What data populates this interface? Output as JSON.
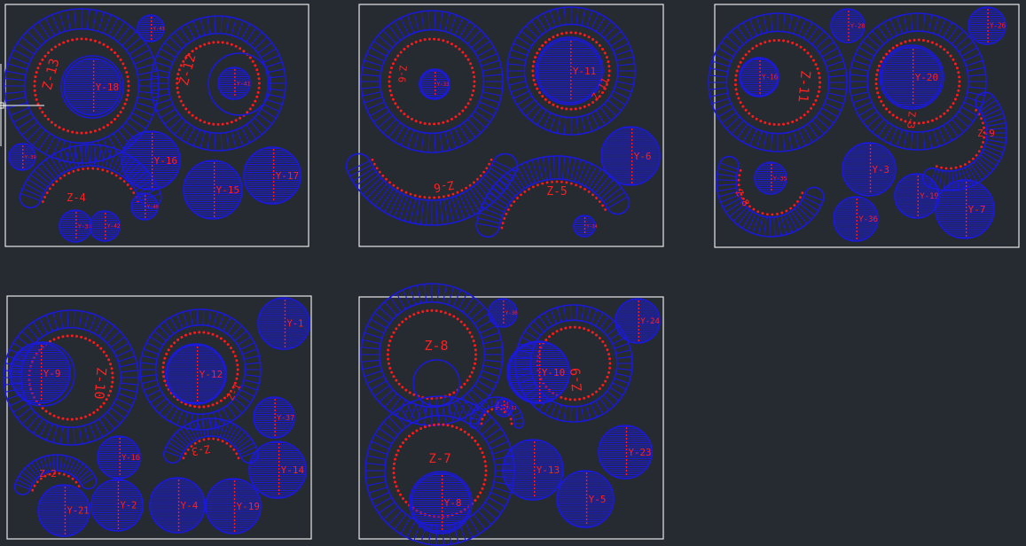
{
  "colors": {
    "background": "#262a31",
    "frame": "#e8e8e8",
    "part": "#1a1ad8",
    "mark": "#ff1a1a"
  },
  "sheets": [
    {
      "rings": [
        {
          "label": "Z-13",
          "lrot": -75,
          "lsize": 15
        },
        {
          "label": "Z-12",
          "lrot": -75,
          "lsize": 15
        }
      ],
      "arcs": [
        {
          "label": "Z-4",
          "lrot": 0,
          "lsize": 12
        }
      ],
      "discs": [
        {
          "label": "Y-18"
        },
        {
          "label": "Y-16"
        },
        {
          "label": "Y-15"
        },
        {
          "label": "Y-17"
        },
        {
          "label": "Y-41"
        },
        {
          "label": "Y-43"
        },
        {
          "label": "Y-39"
        },
        {
          "label": "Y-40"
        },
        {
          "label": "Y-38"
        },
        {
          "label": "Y-42"
        }
      ]
    },
    {
      "rings": [
        {
          "label": "Z-6",
          "lrot": 95,
          "lsize": 11
        },
        {
          "label": "Z-11",
          "lrot": -60,
          "lsize": 11
        }
      ],
      "arcs": [
        {
          "label": "Z-6",
          "lrot": 170,
          "lsize": 13
        },
        {
          "label": "Z-5",
          "lrot": 0,
          "lsize": 13
        }
      ],
      "discs": [
        {
          "label": "Y-33"
        },
        {
          "label": "Y-11"
        },
        {
          "label": "Y-6"
        },
        {
          "label": "Y-34"
        }
      ]
    },
    {
      "rings": [
        {
          "label": "Z-11",
          "lrot": 95,
          "lsize": 15
        },
        {
          "label": "Z-3",
          "lrot": 95,
          "lsize": 11
        }
      ],
      "arcs": [
        {
          "label": "Z-8",
          "lrot": 60,
          "lsize": 11
        },
        {
          "label": "Z-9",
          "lrot": 0,
          "lsize": 11
        }
      ],
      "discs": [
        {
          "label": "Y-20"
        },
        {
          "label": "Y-3"
        },
        {
          "label": "Y-19"
        },
        {
          "label": "Y-7"
        },
        {
          "label": "Y-16"
        },
        {
          "label": "Y-35"
        },
        {
          "label": "Y-36"
        },
        {
          "label": "Y-28"
        },
        {
          "label": "Y-26"
        }
      ]
    },
    {
      "rings": [
        {
          "label": "Z-10",
          "lrot": 95,
          "lsize": 15
        },
        {
          "label": "Z-1",
          "lrot": -60,
          "lsize": 11
        }
      ],
      "arcs": [
        {
          "label": "Z-3",
          "lrot": 170,
          "lsize": 12
        },
        {
          "label": "Z-2",
          "lrot": 0,
          "lsize": 11
        }
      ],
      "discs": [
        {
          "label": "Y-9"
        },
        {
          "label": "Y-12"
        },
        {
          "label": "Y-1"
        },
        {
          "label": "Y-37"
        },
        {
          "label": "Y-14"
        },
        {
          "label": "Y-16"
        },
        {
          "label": "Y-21"
        },
        {
          "label": "Y-2"
        },
        {
          "label": "Y-4"
        },
        {
          "label": "Y-19"
        }
      ]
    },
    {
      "rings": [
        {
          "label": "Z-8",
          "lrot": 0,
          "lsize": 15
        },
        {
          "label": "Z-9",
          "lrot": -95,
          "lsize": 15
        },
        {
          "label": "Z-7",
          "lrot": 0,
          "lsize": 14
        }
      ],
      "arcs": [
        {
          "label": "Z-4",
          "lrot": 0,
          "lsize": 9
        }
      ],
      "discs": [
        {
          "label": "Y-10"
        },
        {
          "label": "Y-30"
        },
        {
          "label": "Y-24"
        },
        {
          "label": "Y-13"
        },
        {
          "label": "Y-23"
        },
        {
          "label": "Y-5"
        },
        {
          "label": "Y-8"
        },
        {
          "label": "Y-31"
        }
      ]
    }
  ]
}
